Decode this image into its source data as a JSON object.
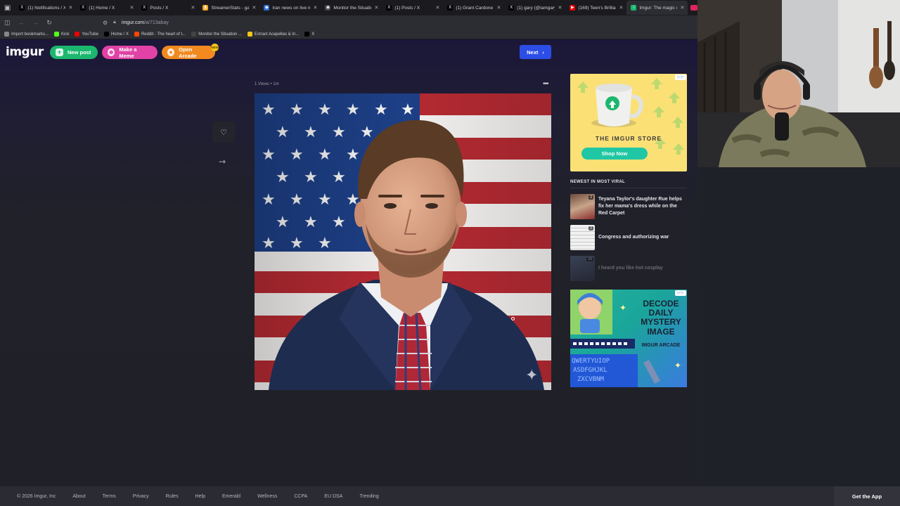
{
  "browser": {
    "tabs": [
      {
        "title": "(1) Notifications / X",
        "favicon": "x-icon",
        "active": false
      },
      {
        "title": "(1) Home / X",
        "favicon": "x-icon",
        "active": false
      },
      {
        "title": "Posts / X",
        "favicon": "x-icon",
        "active": false
      },
      {
        "title": "StreamerStats - garyd",
        "favicon": "bar-chart-icon",
        "active": false
      },
      {
        "title": "Iran news on live map",
        "favicon": "map-icon",
        "active": false
      },
      {
        "title": "Monitor the Situation",
        "favicon": "monitor-icon",
        "active": false
      },
      {
        "title": "(1) Posts / X",
        "favicon": "x-icon",
        "active": false
      },
      {
        "title": "(1) Grant Cardone on",
        "favicon": "x-icon",
        "active": false
      },
      {
        "title": "(1) gary (@iamgarydo",
        "favicon": "x-icon",
        "active": false
      },
      {
        "title": "(169) Teen's Brilliant I",
        "favicon": "youtube-icon",
        "active": false
      },
      {
        "title": "Imgur: The magic of t",
        "favicon": "imgur-icon",
        "active": true
      }
    ],
    "url_host": "imgur.com",
    "url_path": "/a/713abay",
    "bookmarks": [
      {
        "label": "Import bookmarks...",
        "icon": "bookmark-import-icon"
      },
      {
        "label": "Kick",
        "icon": "kick-icon"
      },
      {
        "label": "YouTube",
        "icon": "youtube-icon"
      },
      {
        "label": "Home / X",
        "icon": "x-icon"
      },
      {
        "label": "Reddit - The heart of t...",
        "icon": "reddit-icon"
      },
      {
        "label": "Monitor the Situation ...",
        "icon": "monitor-icon"
      },
      {
        "label": "Extract Acapellas & In...",
        "icon": "music-icon"
      },
      {
        "label": "X",
        "icon": "x-icon"
      }
    ]
  },
  "imgur": {
    "logo": "imgur",
    "new_post": "New post",
    "make_meme": "Make a Meme",
    "open_arcade": "Open Arcade",
    "arcade_badge": "NEW",
    "next": "Next",
    "post_meta": "1 Views • 1m",
    "sidebar_ad": {
      "title": "THE IMGUR STORE",
      "cta": "Shop Now"
    },
    "newest_title": "NEWEST IN MOST VIRAL",
    "viral": [
      {
        "title": "Teyana Taylor's daughter Rue helps fix her mama's dress while on the Red Carpet",
        "count": "2",
        "dim": false
      },
      {
        "title": "Congress and authorizing war",
        "count": "2",
        "dim": false
      },
      {
        "title": "I heard you like hot cosplay",
        "count": "23",
        "dim": true
      }
    ],
    "arcade_ad": {
      "headline": "DECODE DAILY MYSTERY IMAGE",
      "sub": "IMGUR ARCADE"
    }
  },
  "footer": {
    "copyright": "© 2026 Imgur, Inc",
    "links": [
      "About",
      "Terms",
      "Privacy",
      "Rules",
      "Help",
      "Emerald",
      "Wellness",
      "CCPA",
      "EU DSA",
      "Trending"
    ],
    "get_app": "Get the App"
  },
  "colors": {
    "new_post": "#1bb76e",
    "make_meme": "#e043a5",
    "open_arcade": "#f28a20",
    "next": "#2c4ee6",
    "shop_now": "#1fc7a4"
  }
}
